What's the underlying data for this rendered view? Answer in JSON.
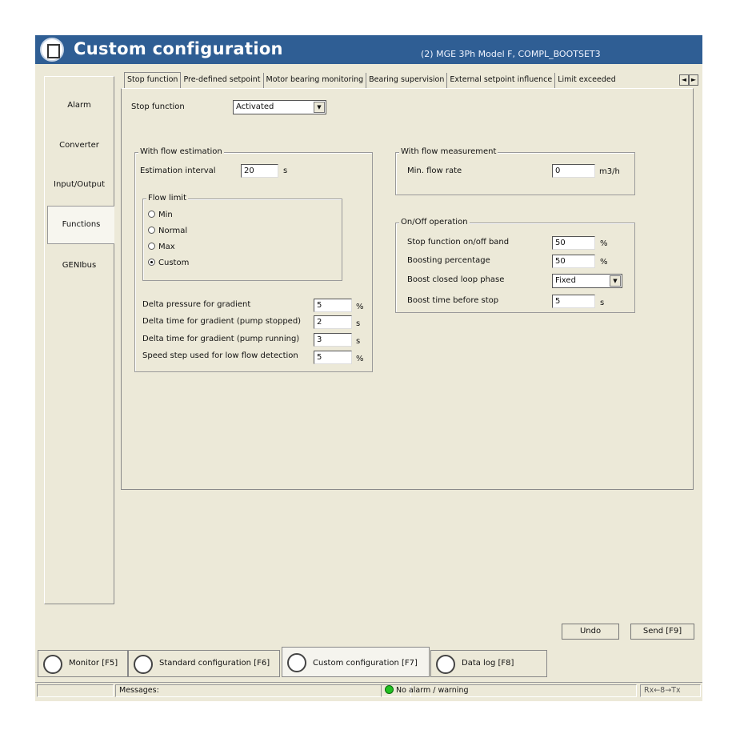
{
  "window": {
    "title": "Custom configuration",
    "device": "(2) MGE 3Ph Model F, COMPL_BOOTSET3"
  },
  "sidebar": {
    "items": [
      {
        "label": "Alarm"
      },
      {
        "label": "Converter"
      },
      {
        "label": "Input/Output"
      },
      {
        "label": "Functions",
        "selected": true
      },
      {
        "label": "GENIbus"
      }
    ]
  },
  "tabs": [
    {
      "label": "Stop function",
      "selected": true
    },
    {
      "label": "Pre-defined setpoint"
    },
    {
      "label": "Motor bearing monitoring"
    },
    {
      "label": "Bearing supervision"
    },
    {
      "label": "External setpoint influence"
    },
    {
      "label": "Limit exceeded"
    }
  ],
  "tab_scroll": {
    "left": "◄",
    "right": "►"
  },
  "stop_function": {
    "label": "Stop function",
    "value": "Activated"
  },
  "flow_estimation": {
    "title": "With flow estimation",
    "interval_label": "Estimation interval",
    "interval_value": "20",
    "interval_unit": "s",
    "flow_limit": {
      "title": "Flow limit",
      "options": [
        "Min",
        "Normal",
        "Max",
        "Custom"
      ],
      "selected": "Custom"
    },
    "rows": [
      {
        "label": "Delta pressure for gradient",
        "value": "5",
        "unit": "%"
      },
      {
        "label": "Delta time for gradient (pump stopped)",
        "value": "2",
        "unit": "s"
      },
      {
        "label": "Delta time for gradient (pump running)",
        "value": "3",
        "unit": "s"
      },
      {
        "label": "Speed step used for low flow detection",
        "value": "5",
        "unit": "%"
      }
    ]
  },
  "flow_measurement": {
    "title": "With flow measurement",
    "min_flow_label": "Min. flow rate",
    "min_flow_value": "0",
    "min_flow_unit": "m3/h"
  },
  "onoff": {
    "title": "On/Off operation",
    "band_label": "Stop function on/off band",
    "band_value": "50",
    "band_unit": "%",
    "boost_pct_label": "Boosting percentage",
    "boost_pct_value": "50",
    "boost_pct_unit": "%",
    "boost_phase_label": "Boost closed loop phase",
    "boost_phase_value": "Fixed",
    "boost_time_label": "Boost time before stop",
    "boost_time_value": "5",
    "boost_time_unit": "s"
  },
  "buttons": {
    "undo": "Undo",
    "send": "Send [F9]"
  },
  "bottom_tabs": [
    {
      "label": "Monitor [F5]",
      "icon": "magnifier-icon"
    },
    {
      "label": "Standard configuration [F6]",
      "icon": "standard-config-icon"
    },
    {
      "label": "Custom configuration [F7]",
      "icon": "custom-config-icon",
      "selected": true
    },
    {
      "label": "Data log [F8]",
      "icon": "data-log-icon"
    }
  ],
  "status": {
    "messages_label": "Messages:",
    "alarm_text": "No alarm / warning",
    "alarm_color": "#22c022",
    "comm_text": "Rx←8→Tx"
  },
  "colors": {
    "titlebar": "#2f5e94",
    "panel": "#ece9d8"
  }
}
